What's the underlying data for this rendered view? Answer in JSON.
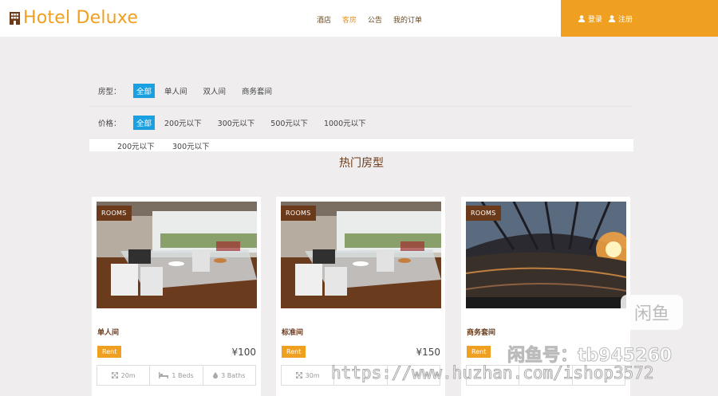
{
  "header": {
    "logo_title": "Hotel Deluxe",
    "nav": [
      {
        "label": "酒店",
        "active": false
      },
      {
        "label": "客房",
        "active": true
      },
      {
        "label": "公告",
        "active": false
      },
      {
        "label": "我的订单",
        "active": false
      }
    ],
    "login_label": "登录",
    "register_label": "注册"
  },
  "filters": {
    "type_label": "房型：",
    "type_options": [
      "全部",
      "单人间",
      "双人间",
      "商务套间"
    ],
    "price_label": "价格：",
    "price_options": [
      "全部",
      "200元以下",
      "300元以下",
      "500元以下",
      "1000元以下"
    ],
    "extra_options": [
      "200元以下",
      "300元以下"
    ]
  },
  "section_title": "热门房型",
  "rooms": [
    {
      "badge": "ROOMS",
      "name": "单人间",
      "rent": "Rent",
      "price": "¥100",
      "area": "20m",
      "beds": "1 Beds",
      "baths": "3 Baths"
    },
    {
      "badge": "ROOMS",
      "name": "标准间",
      "rent": "Rent",
      "price": "¥150",
      "area": "30m",
      "beds": "",
      "baths": ""
    },
    {
      "badge": "ROOMS",
      "name": "商务套间",
      "rent": "Rent",
      "price": "",
      "area": "",
      "beds": "",
      "baths": ""
    }
  ],
  "watermark": {
    "box_text": "闲鱼",
    "line1": "闲鱼号：tb945260",
    "line2": "https://www.huzhan.com/ishop3572"
  },
  "colors": {
    "accent": "#f0a020",
    "brown": "#6b3a1a",
    "filter_selected": "#1aa0e0"
  }
}
